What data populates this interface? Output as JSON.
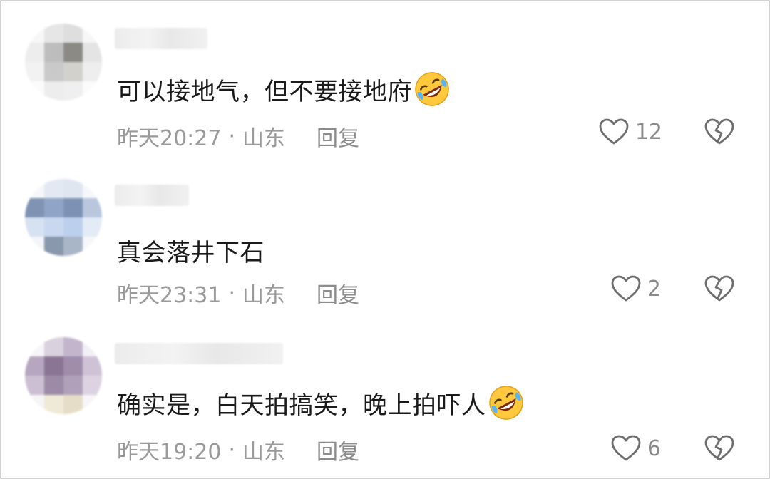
{
  "comments": [
    {
      "text": "可以接地气，但不要接地府",
      "emoji": "rofl-emoji",
      "time": "昨天20:27",
      "separator": "·",
      "location": "山东",
      "reply_label": "回复",
      "likes": "12",
      "avatar_colors": [
        "#f7f7f7",
        "#e6e6e6",
        "#dedede",
        "#f7f7f7",
        "#ededed",
        "#bdbdbd",
        "#8b8a84",
        "#e4e4e4",
        "#f2f2f2",
        "#c9c9c9",
        "#d2d1cc",
        "#eeeeee",
        "#fbfbfb",
        "#ededed",
        "#efefef",
        "#fbfbfb"
      ]
    },
    {
      "text": "真会落井下石",
      "emoji": "",
      "time": "昨天23:31",
      "separator": "·",
      "location": "山东",
      "reply_label": "回复",
      "likes": "2",
      "avatar_colors": [
        "#f5f7fa",
        "#e3e9f2",
        "#dfe6f0",
        "#f5f7fa",
        "#8093b3",
        "#8fa4c6",
        "#7d91b4",
        "#b8c7de",
        "#d6e1f1",
        "#c9d8ef",
        "#bcd0ee",
        "#e3ebf6",
        "#f3f5f8",
        "#8a98ad",
        "#a9b6c8",
        "#f5f7fa"
      ]
    },
    {
      "text": "确实是，白天拍搞笑，晚上拍吓人",
      "emoji": "rofl-emoji",
      "time": "昨天19:20",
      "separator": "·",
      "location": "山东",
      "reply_label": "回复",
      "likes": "6",
      "avatar_colors": [
        "#f7f5f8",
        "#d9d1de",
        "#c3b6cc",
        "#f3f0f5",
        "#b7a6bf",
        "#8b7595",
        "#a08dab",
        "#cfc2d6",
        "#cdbfd3",
        "#9c8aa6",
        "#b0a0b9",
        "#ddd2e2",
        "#f6f4f6",
        "#efe9d8",
        "#e6ddc8",
        "#f7f5f8"
      ]
    }
  ],
  "icons": {
    "like": "heart-outline-icon",
    "dislike": "broken-heart-icon"
  },
  "colors": {
    "text": "#1a1a1a",
    "meta": "#9a9a9a",
    "icon_stroke": "#6e6e6e"
  }
}
